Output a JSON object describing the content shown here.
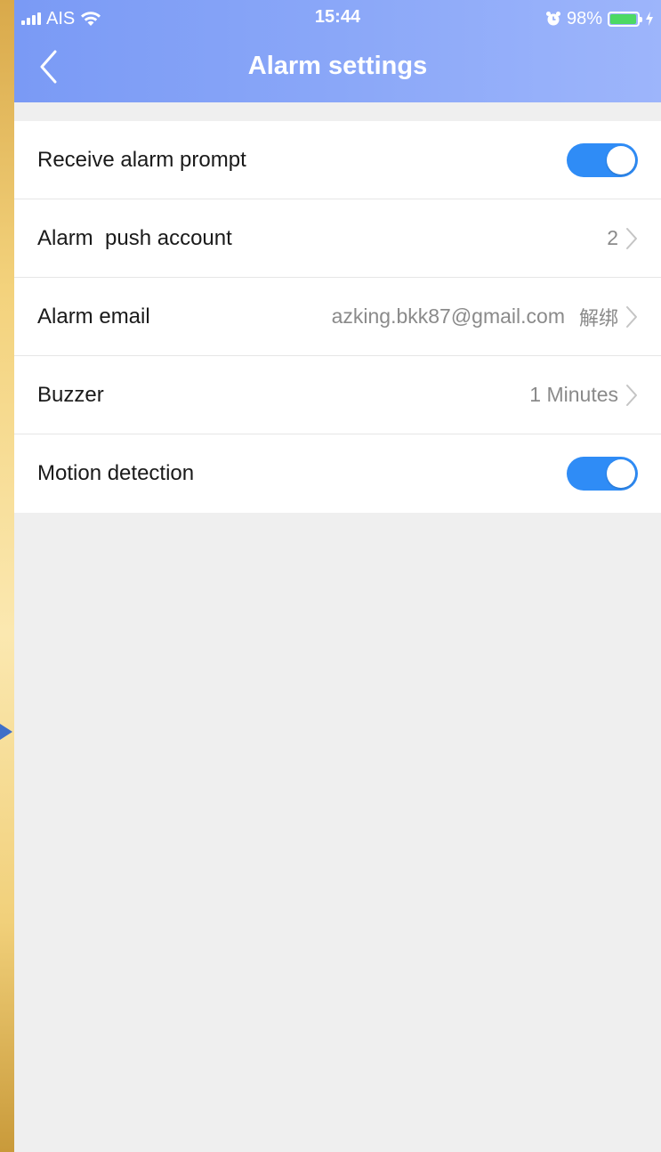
{
  "status_bar": {
    "carrier": "AIS",
    "time": "15:44",
    "battery_percent": "98%",
    "battery_level": 0.98
  },
  "nav": {
    "title": "Alarm settings",
    "back_icon": "chevron-left-icon"
  },
  "colors": {
    "header_start": "#7a9af5",
    "header_end": "#9db5fb",
    "toggle_on": "#2f8cf6",
    "page_background": "#efefef"
  },
  "settings": {
    "receive_alarm_prompt": {
      "label": "Receive alarm prompt",
      "enabled": true
    },
    "alarm_push_account": {
      "label": "Alarm  push account",
      "value": "2"
    },
    "alarm_email": {
      "label": "Alarm email",
      "value": "azking.bkk87@gmail.com",
      "action": "解绑"
    },
    "buzzer": {
      "label": "Buzzer",
      "value": "1 Minutes"
    },
    "motion_detection": {
      "label": "Motion detection",
      "enabled": true
    }
  }
}
